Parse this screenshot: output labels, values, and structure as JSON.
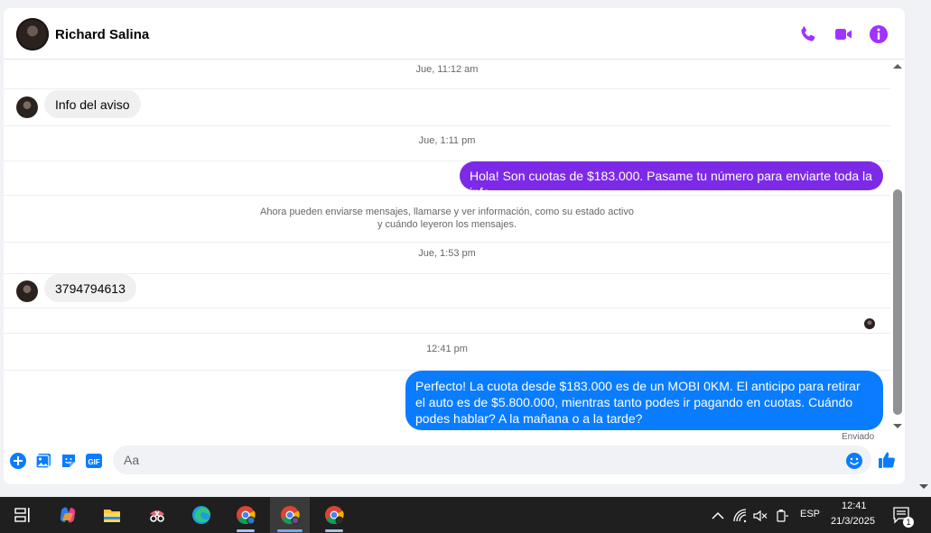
{
  "contact": {
    "name": "Richard Salina"
  },
  "header_actions": [
    {
      "icon": "phone-icon",
      "label": "audio-call"
    },
    {
      "icon": "video-icon",
      "label": "video-call"
    },
    {
      "icon": "info-icon",
      "label": "conversation-info"
    }
  ],
  "colors": {
    "accent": "#a033ff",
    "outgoing_purple": "#7d2ae8",
    "outgoing_blue": "#0a7cff",
    "incoming": "#f0f0f0",
    "taskbar": "#1f1f1f"
  },
  "messages": {
    "ts1": "Jue, 11:12 am",
    "msg1": "Info del aviso",
    "ts2": "Jue, 1:11 pm",
    "msg2": "Hola! Son cuotas de $183.000. Pasame tu número para enviarte toda la info",
    "system_line1": "Ahora pueden enviarse mensajes, llamarse y ver información, como su estado activo",
    "system_line2": "y cuándo leyeron los mensajes.",
    "ts3": "Jue, 1:53 pm",
    "msg3": "3794794613",
    "ts4": "12:41 pm",
    "msg4": "Perfecto! La cuota desde $183.000 es de un MOBI 0KM. El anticipo para retirar el auto es de $5.800.000, mientras tanto podes ir pagando en cuotas. Cuándo podes hablar? A la mañana o a la tarde?",
    "status": "Enviado"
  },
  "composer": {
    "placeholder": "Aa",
    "icons": [
      "plus-icon",
      "image-icon",
      "sticker-icon",
      "gif-icon",
      "emoji-icon",
      "thumbs-up-icon"
    ],
    "gif_label": "GIF"
  },
  "taskbar": {
    "apps": [
      "task-view",
      "copilot",
      "file-explorer",
      "snipping-tool",
      "edge",
      "chrome-profile-1",
      "chrome-profile-2",
      "chrome-profile-3"
    ],
    "language": "ESP",
    "time": "12:41",
    "date": "21/3/2025",
    "notification_count": "1"
  }
}
